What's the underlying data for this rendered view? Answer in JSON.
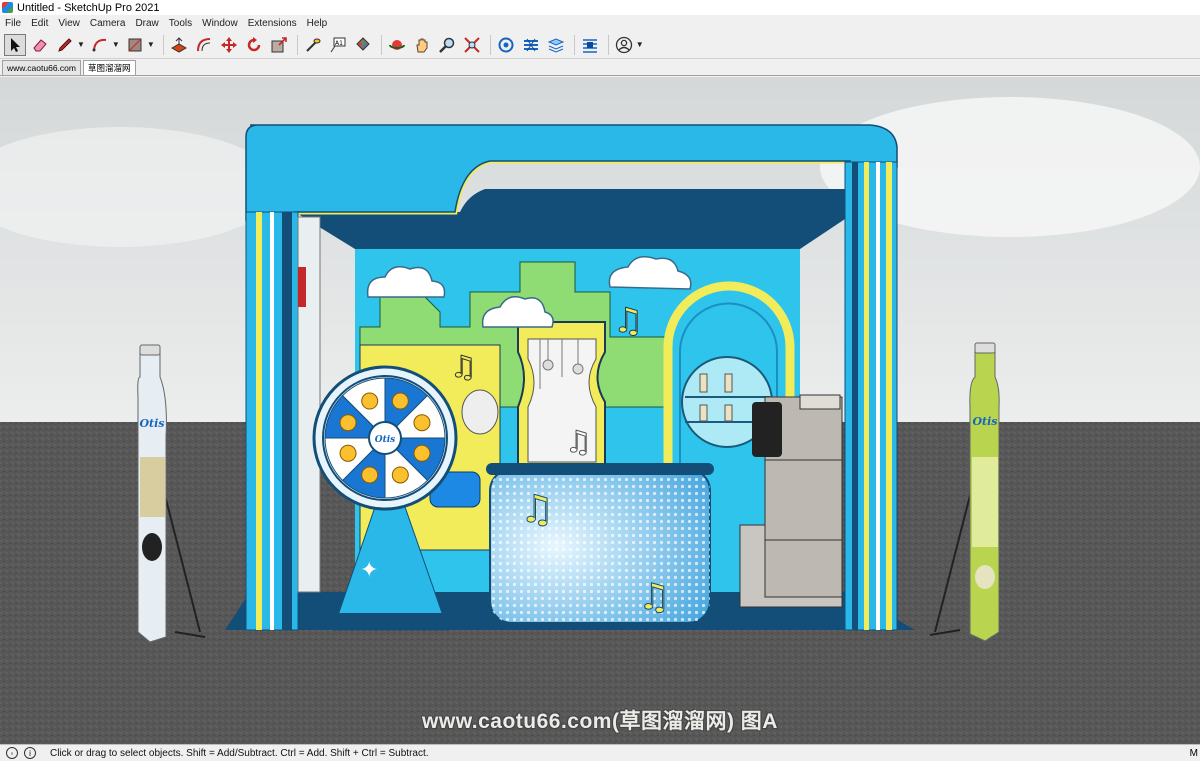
{
  "window": {
    "title": "Untitled - SketchUp Pro 2021"
  },
  "menu": [
    "File",
    "Edit",
    "View",
    "Camera",
    "Draw",
    "Tools",
    "Window",
    "Extensions",
    "Help"
  ],
  "toolbar": {
    "tools": [
      {
        "icon": "select-arrow-icon",
        "active": true,
        "dropdown": false
      },
      {
        "icon": "eraser-icon",
        "dropdown": false
      },
      {
        "icon": "pencil-line-icon",
        "dropdown": true
      },
      {
        "icon": "arc-icon",
        "dropdown": true
      },
      {
        "icon": "rectangle-shape-icon",
        "dropdown": true
      },
      {
        "icon": "push-pull-icon",
        "dropdown": false
      },
      {
        "icon": "offset-icon",
        "dropdown": false
      },
      {
        "icon": "move-icon",
        "dropdown": false
      },
      {
        "icon": "rotate-icon",
        "dropdown": false
      },
      {
        "icon": "scale-icon",
        "dropdown": false
      },
      {
        "icon": "tape-measure-icon",
        "dropdown": false
      },
      {
        "icon": "text-icon",
        "dropdown": false
      },
      {
        "icon": "paint-bucket-icon",
        "dropdown": false
      },
      {
        "icon": "orbit-icon",
        "dropdown": false
      },
      {
        "icon": "pan-icon",
        "dropdown": false
      },
      {
        "icon": "zoom-icon",
        "dropdown": false
      },
      {
        "icon": "zoom-extents-icon",
        "dropdown": false
      },
      {
        "icon": "warehouse-icon",
        "dropdown": false
      },
      {
        "icon": "extension-warehouse-icon",
        "dropdown": false
      },
      {
        "icon": "layout-icon",
        "dropdown": false
      },
      {
        "icon": "extension-manager-icon",
        "dropdown": false
      },
      {
        "icon": "account-icon",
        "dropdown": true
      }
    ]
  },
  "tabs": [
    {
      "label": "www.caotu66.com",
      "active": false
    },
    {
      "label": "草图溜溜网",
      "active": true
    }
  ],
  "viewport": {
    "watermark": "www.caotu66.com(草图溜溜网) 图A",
    "banner_brand": "Otis",
    "wheel_brand": "Otis",
    "colors": {
      "sky": "#e3e5e5",
      "ground": "#585858",
      "booth_blue": "#29b8e8",
      "booth_navy": "#134e78",
      "accent_yellow": "#f2ec5a",
      "cloud": "#ffffff"
    }
  },
  "status": {
    "message": "Click or drag to select objects. Shift = Add/Subtract. Ctrl = Add. Shift + Ctrl = Subtract.",
    "measurements_label": "M"
  }
}
